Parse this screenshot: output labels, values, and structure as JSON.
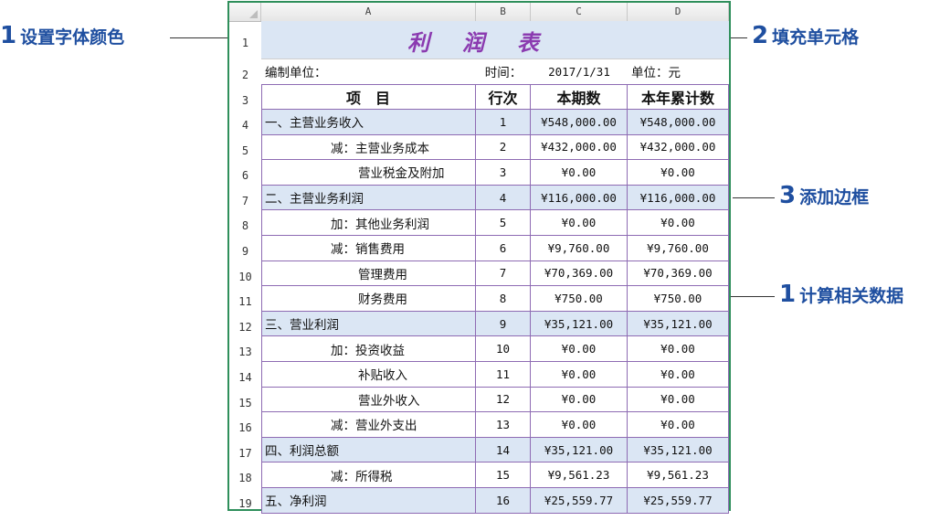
{
  "columns": [
    "A",
    "B",
    "C",
    "D"
  ],
  "rows": [
    "1",
    "2",
    "3",
    "4",
    "5",
    "6",
    "7",
    "8",
    "9",
    "10",
    "11",
    "12",
    "13",
    "14",
    "15",
    "16",
    "17",
    "18",
    "19"
  ],
  "title": "利润表",
  "title_chars": [
    "利",
    "润",
    "表"
  ],
  "info": {
    "unit_label": "编制单位：",
    "time_label": "时间：",
    "date": "2017/1/31",
    "currency": "单位：元"
  },
  "headers": [
    "项　目",
    "行次",
    "本期数",
    "本年累计数"
  ],
  "items": [
    {
      "label": "一、主营业务收入",
      "line": "1",
      "current": "¥548,000.00",
      "ytd": "¥548,000.00"
    },
    {
      "label": "减：主营业务成本",
      "line": "2",
      "current": "¥432,000.00",
      "ytd": "¥432,000.00"
    },
    {
      "label": "营业税金及附加",
      "line": "3",
      "current": "¥0.00",
      "ytd": "¥0.00"
    },
    {
      "label": "二、主营业务利润",
      "line": "4",
      "current": "¥116,000.00",
      "ytd": "¥116,000.00"
    },
    {
      "label": "加：其他业务利润",
      "line": "5",
      "current": "¥0.00",
      "ytd": "¥0.00"
    },
    {
      "label": "减：销售费用",
      "line": "6",
      "current": "¥9,760.00",
      "ytd": "¥9,760.00"
    },
    {
      "label": "管理费用",
      "line": "7",
      "current": "¥70,369.00",
      "ytd": "¥70,369.00"
    },
    {
      "label": "财务费用",
      "line": "8",
      "current": "¥750.00",
      "ytd": "¥750.00"
    },
    {
      "label": "三、营业利润",
      "line": "9",
      "current": "¥35,121.00",
      "ytd": "¥35,121.00"
    },
    {
      "label": "加：投资收益",
      "line": "10",
      "current": "¥0.00",
      "ytd": "¥0.00"
    },
    {
      "label": "补贴收入",
      "line": "11",
      "current": "¥0.00",
      "ytd": "¥0.00"
    },
    {
      "label": "营业外收入",
      "line": "12",
      "current": "¥0.00",
      "ytd": "¥0.00"
    },
    {
      "label": "减：营业外支出",
      "line": "13",
      "current": "¥0.00",
      "ytd": "¥0.00"
    },
    {
      "label": "四、利润总额",
      "line": "14",
      "current": "¥35,121.00",
      "ytd": "¥35,121.00"
    },
    {
      "label": "减：所得税",
      "line": "15",
      "current": "¥9,561.23",
      "ytd": "¥9,561.23"
    },
    {
      "label": "五、净利润",
      "line": "16",
      "current": "¥25,559.77",
      "ytd": "¥25,559.77"
    }
  ],
  "annotations": {
    "font_color": {
      "num": "1",
      "text": "设置字体颜色"
    },
    "fill_cells": {
      "num": "2",
      "text": "填充单元格"
    },
    "add_border": {
      "num": "3",
      "text": "添加边框"
    },
    "calc_data": {
      "num": "1",
      "text": "计算相关数据"
    }
  },
  "colors": {
    "frame": "#2f8f5b",
    "fill": "#dbe6f4",
    "title_text": "#8b3bb0",
    "border": "#8e6bb3",
    "annotation": "#1f4fa0"
  }
}
